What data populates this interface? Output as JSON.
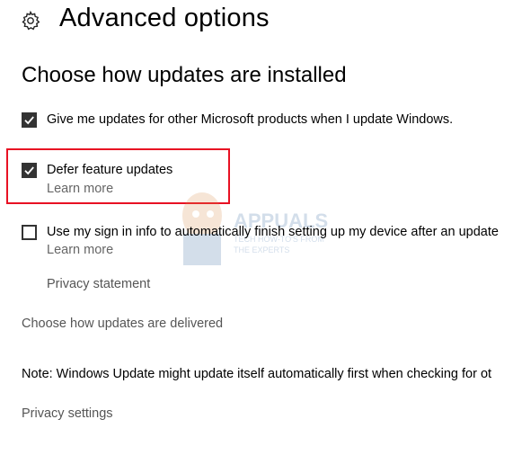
{
  "header": {
    "icon": "gear-icon",
    "title": "Advanced options"
  },
  "section": {
    "heading": "Choose how updates are installed"
  },
  "options": [
    {
      "label": "Give me updates for other Microsoft products when I update Windows.",
      "checked": true
    },
    {
      "label": "Defer feature updates",
      "checked": true,
      "link": "Learn more"
    },
    {
      "label": "Use my sign in info to automatically finish setting up my device after an update",
      "checked": false,
      "link": "Learn more"
    }
  ],
  "privacy_statement": "Privacy statement",
  "delivery_link": "Choose how updates are delivered",
  "note": "Note: Windows Update might update itself automatically first when checking for ot",
  "privacy_settings": "Privacy settings",
  "watermark": {
    "brand": "APPUALS",
    "tagline_1": "TECH HOW-TO'S FROM",
    "tagline_2": "THE EXPERTS"
  },
  "colors": {
    "highlight": "#e81123",
    "checkbox_fill": "#333333",
    "link": "#666666"
  }
}
